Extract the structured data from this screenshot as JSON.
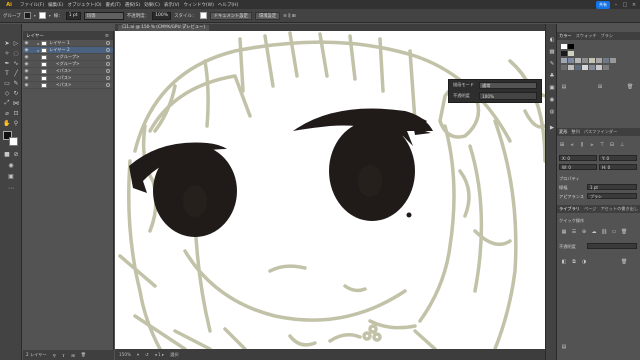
{
  "app": {
    "logo_text": "Ai"
  },
  "menu": {
    "items": [
      "ファイル(F)",
      "編集(E)",
      "オブジェクト(O)",
      "書式(T)",
      "選択(S)",
      "効果(C)",
      "表示(V)",
      "ウィンドウ(W)",
      "ヘルプ(H)"
    ],
    "share_label": "共有"
  },
  "control_bar": {
    "selection_label": "グループ",
    "stroke_label": "線：",
    "stroke_width": "1 pt",
    "style_label": "均等",
    "opacity_label": "不透明度：",
    "opacity_value": "100%",
    "style_field_label": "スタイル：",
    "doc_setup_button": "ドキュメント設定",
    "preferences_button": "環境設定"
  },
  "layers_panel": {
    "tab_label": "レイヤー",
    "layers": [
      {
        "name": "レイヤー 1",
        "selected": false,
        "sub": false
      },
      {
        "name": "レイヤー 2",
        "selected": true,
        "sub": false
      },
      {
        "name": "<グループ>",
        "selected": false,
        "sub": true
      },
      {
        "name": "<グループ>",
        "selected": false,
        "sub": true
      },
      {
        "name": "<パス>",
        "selected": false,
        "sub": true
      },
      {
        "name": "<パス>",
        "selected": false,
        "sub": true
      },
      {
        "name": "<パス>",
        "selected": false,
        "sub": true
      }
    ],
    "footer_label": "2 レイヤー"
  },
  "document": {
    "tab_label": "ロ1.ai @ 150 % (CMYK/GPU プレビュー)",
    "zoom": "150%",
    "status_tool": "選択"
  },
  "opacity_popup": {
    "mode_label": "描画モード",
    "mode_value": "通常",
    "opacity_label": "不透明度",
    "opacity_value": "100%"
  },
  "right_panel": {
    "top_tabs": [
      "カラー",
      "スウォッチ",
      "ブラシ"
    ],
    "mid_tabs": [
      "変形",
      "整列",
      "パスファインダー"
    ],
    "transform_x": "X: 0",
    "transform_y": "Y: 0",
    "transform_w": "W: 0",
    "transform_h": "H: 0",
    "artboard_label": "プロパティ",
    "shape_label": "線幅",
    "shape_value": "1 pt",
    "appearance_label": "アピアランス",
    "appearance_field": "ブラシ",
    "bottom_tabs": [
      "ライブラリ",
      "ページ",
      "アセットの書き出し"
    ],
    "quick_label": "クイック操作",
    "bottom_field_label": "不透明度"
  },
  "colors": {
    "accent": "#1473e6",
    "sketch": "#c2c2a8",
    "eyes": "#201a18"
  }
}
